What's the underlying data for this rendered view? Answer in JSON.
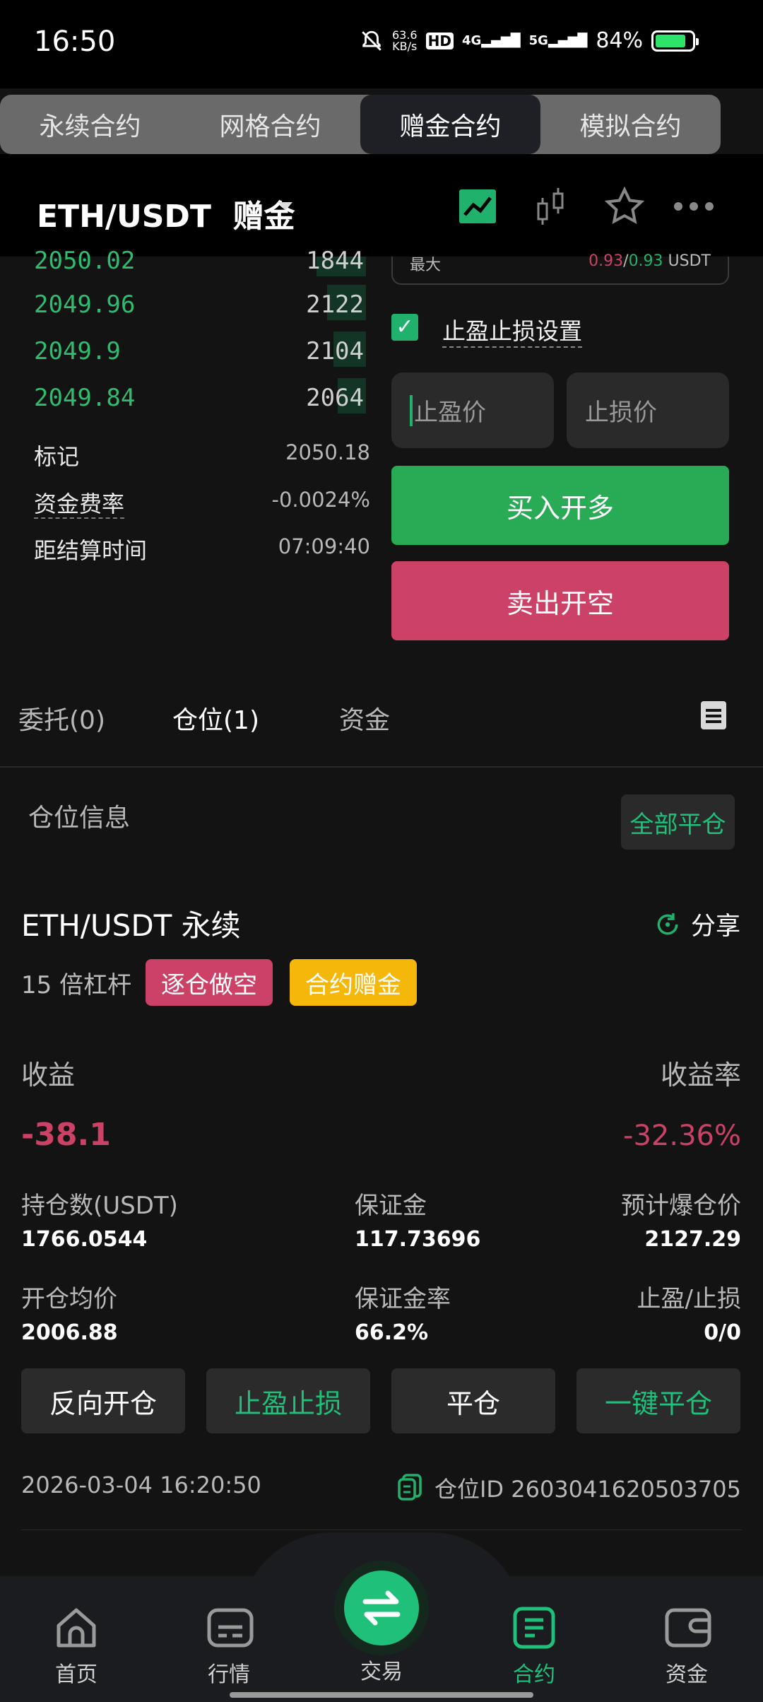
{
  "status_bar": {
    "time": "16:50",
    "net_speed_value": "63.6",
    "net_speed_unit": "KB/s",
    "hd_label": "HD",
    "signal_4g": "4G",
    "signal_5g": "5G",
    "battery": "84%",
    "battery_level": 0.84
  },
  "contract_tabs": [
    "永续合约",
    "网格合约",
    "赠金合约",
    "模拟合约"
  ],
  "contract_tabs_active": 2,
  "header": {
    "pair": "ETH/USDT",
    "mode": "赠金"
  },
  "order_book": {
    "asks": [
      {
        "price": "2050.02",
        "qty": "1844"
      },
      {
        "price": "2049.96",
        "qty": "2122"
      },
      {
        "price": "2049.9",
        "qty": "2104"
      },
      {
        "price": "2049.84",
        "qty": "2064"
      }
    ],
    "mark_label": "标记",
    "mark_value": "2050.18",
    "funding_label": "资金费率",
    "funding_value": "-0.0024%",
    "settle_label": "距结算时间",
    "settle_value": "07:09:40"
  },
  "order_panel": {
    "max_label": "最大",
    "max_value_red": "0.93",
    "max_sep": "/",
    "max_value_green": "0.93",
    "max_unit": "USDT",
    "tp_sl_label": "止盈止损设置",
    "tp_placeholder": "止盈价",
    "sl_placeholder": "止损价",
    "buy_label": "买入开多",
    "sell_label": "卖出开空"
  },
  "sub_tabs": [
    "委托(0)",
    "仓位(1)",
    "资金"
  ],
  "sub_tabs_active": 1,
  "position": {
    "section_title": "仓位信息",
    "close_all": "全部平仓",
    "symbol": "ETH/USDT 永续",
    "share": "分享",
    "leverage": "15 倍杠杆",
    "badge_side": "逐仓做空",
    "badge_bonus": "合约赠金",
    "pnl_label": "收益",
    "pnl_value": "-38.1",
    "roe_label": "收益率",
    "roe_value": "-32.36%",
    "size_label": "持仓数(USDT)",
    "size_value": "1766.0544",
    "margin_label": "保证金",
    "margin_value": "117.73696",
    "liq_label": "预计爆仓价",
    "liq_value": "2127.29",
    "entry_label": "开仓均价",
    "entry_value": "2006.88",
    "margin_ratio_label": "保证金率",
    "margin_ratio_value": "66.2%",
    "tpsl_label": "止盈/止损",
    "tpsl_value": "0/0",
    "actions": [
      "反向开仓",
      "止盈止损",
      "平仓",
      "一键平仓"
    ],
    "timestamp": "2026-03-04 16:20:50",
    "position_id": "仓位ID 2603041620503705"
  },
  "bottom_nav": [
    "首页",
    "行情",
    "交易",
    "合约",
    "资金"
  ],
  "bottom_nav_active": 3,
  "colors": {
    "green": "#20b26c",
    "red": "#cc4266",
    "yellow": "#f5b70a",
    "accent_text": "#1fc07a"
  }
}
